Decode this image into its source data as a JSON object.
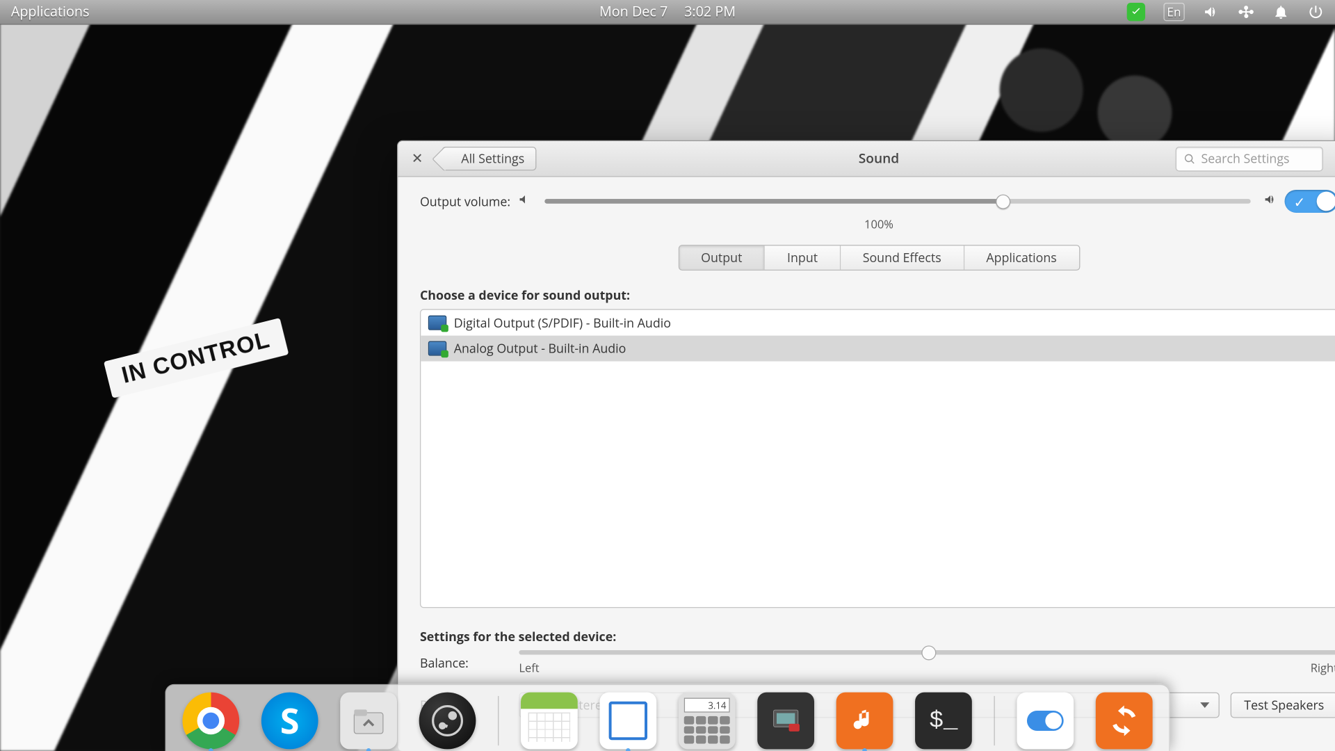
{
  "topbar": {
    "applications": "Applications",
    "date": "Mon Dec 7",
    "time": "3:02 PM",
    "language": "En"
  },
  "window": {
    "back": "All Settings",
    "title": "Sound",
    "search_placeholder": "Search Settings",
    "volume_label": "Output volume:",
    "volume_percent": "100%",
    "tabs": {
      "output": "Output",
      "input": "Input",
      "effects": "Sound Effects",
      "apps": "Applications"
    },
    "choose_device": "Choose a device for sound output:",
    "devices": [
      "Digital Output (S/PDIF) - Built-in Audio",
      "Analog Output - Built-in Audio"
    ],
    "settings_header": "Settings for the selected device:",
    "balance_label": "Balance:",
    "balance_left": "Left",
    "balance_right": "Right",
    "profile_label": "Profile:",
    "profile_value": "Analog Stereo Output",
    "test_btn": "Test Speakers"
  },
  "wallpaper_tag": "IN CONTROL",
  "calc_display": "3.14"
}
